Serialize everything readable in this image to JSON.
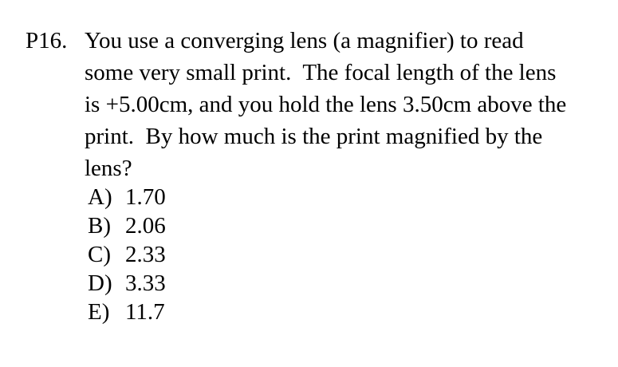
{
  "problem": {
    "number": "P16.",
    "question_lines": [
      "You use a converging lens (a magnifier) to read",
      "some very small print.  The focal length of the lens",
      "is +5.00cm, and you hold the lens 3.50cm above the",
      "print.  By how much is the print magnified by the",
      "lens?"
    ],
    "choices": [
      {
        "letter": "A)",
        "value": "1.70"
      },
      {
        "letter": "B)",
        "value": "2.06"
      },
      {
        "letter": "C)",
        "value": "2.33"
      },
      {
        "letter": "D)",
        "value": "3.33"
      },
      {
        "letter": "E)",
        "value": "11.7"
      }
    ]
  }
}
